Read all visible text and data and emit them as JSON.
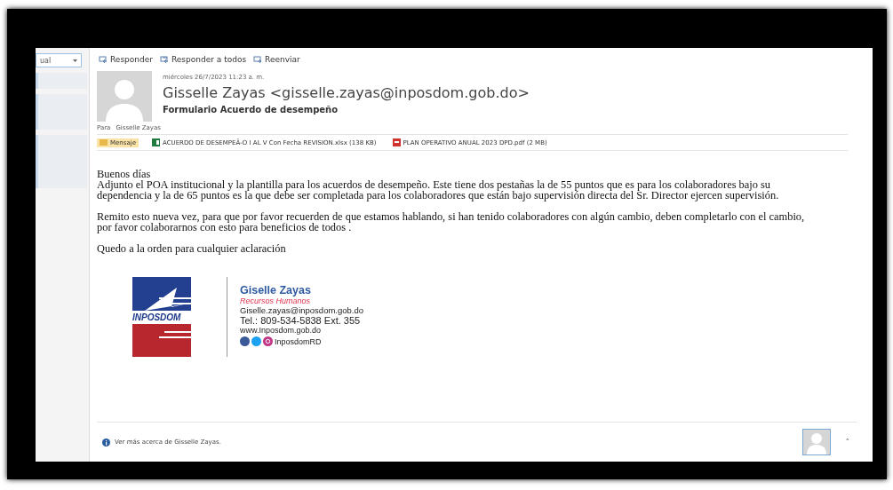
{
  "sidebar": {
    "view_dropdown": "ual"
  },
  "toolbar": [
    {
      "kind": "reply",
      "label": "Responder"
    },
    {
      "kind": "reply-all",
      "label": "Responder a todos"
    },
    {
      "kind": "forward",
      "label": "Reenviar"
    }
  ],
  "message": {
    "date": "miércoles 26/7/2023 11:23 a. m.",
    "sender": "Gisselle Zayas <gisselle.zayas@inposdom.gob.do>",
    "subject": "Formulario Acuerdo de desempeño",
    "to_label": "Para",
    "to": "Gisselle Zayas",
    "attachments": [
      {
        "kind": "message",
        "label": "Mensaje",
        "selected": true
      },
      {
        "kind": "excel",
        "label": "ACUERDO DE DESEMPEÃ-O I AL V Con Fecha REVISION.xlsx (138 KB)",
        "selected": false
      },
      {
        "kind": "pdf",
        "label": "PLAN OPERATIVO ANUAL 2023 DPD.pdf (2 MB)",
        "selected": false
      }
    ],
    "body": [
      [
        "Buenos días",
        "Adjunto el POA institucional y la plantilla para los acuerdos de desempeño. Este tiene dos pestañas la de 55 puntos que es para los colaboradores bajo su dependencia y la de 65 puntos es la que debe ser completada para los colaboradores que están bajo supervisión directa del Sr. Director ejercen supervisión."
      ],
      [
        "Remito esto nueva vez, para que por favor recuerden de que estamos hablando, si han tenido colaboradores con algún cambio, deben completarlo con el cambio, por favor colaborarnos con esto para beneficios de todos ."
      ],
      [
        "Quedo a la orden para cualquier aclaración"
      ]
    ],
    "signature": {
      "logo_text": "INPOSDOM",
      "name": "Giselle Zayas",
      "role": "Recursos Humanos",
      "email": "Giselle.zayas@inposdom.gob.do",
      "phone": "Tel.: 809-534-5838 Ext. 355",
      "web": "www.Inposdom.gob.do",
      "social": "InposdomRD"
    }
  },
  "footer": {
    "text": "Ver más acerca de Gisselle Zayas.",
    "caret": "˄"
  }
}
